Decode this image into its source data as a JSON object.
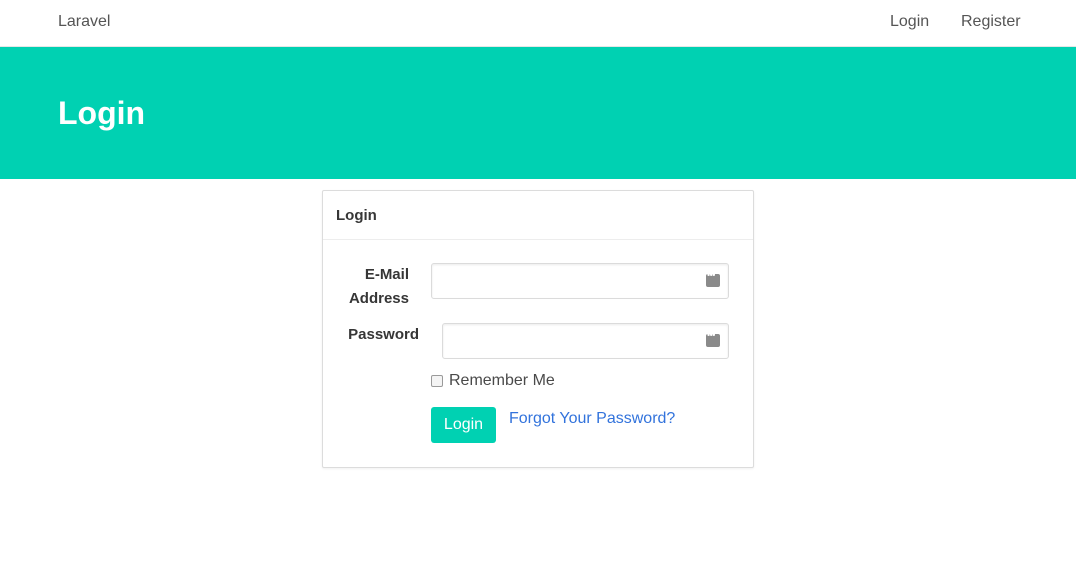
{
  "navbar": {
    "brand": "Laravel",
    "links": [
      "Login",
      "Register"
    ]
  },
  "hero": {
    "title": "Login"
  },
  "card": {
    "title": "Login",
    "email_label": "E-Mail Address",
    "email_value": "",
    "password_label": "Password",
    "password_value": "",
    "remember_label": "Remember Me",
    "remember_checked": false,
    "submit_label": "Login",
    "forgot_label": "Forgot Your Password?"
  },
  "icons": {
    "email_field_icon": "password-manager-icon",
    "password_field_icon": "password-manager-icon"
  },
  "colors": {
    "accent": "#00d1b2",
    "link": "#3273dc"
  }
}
